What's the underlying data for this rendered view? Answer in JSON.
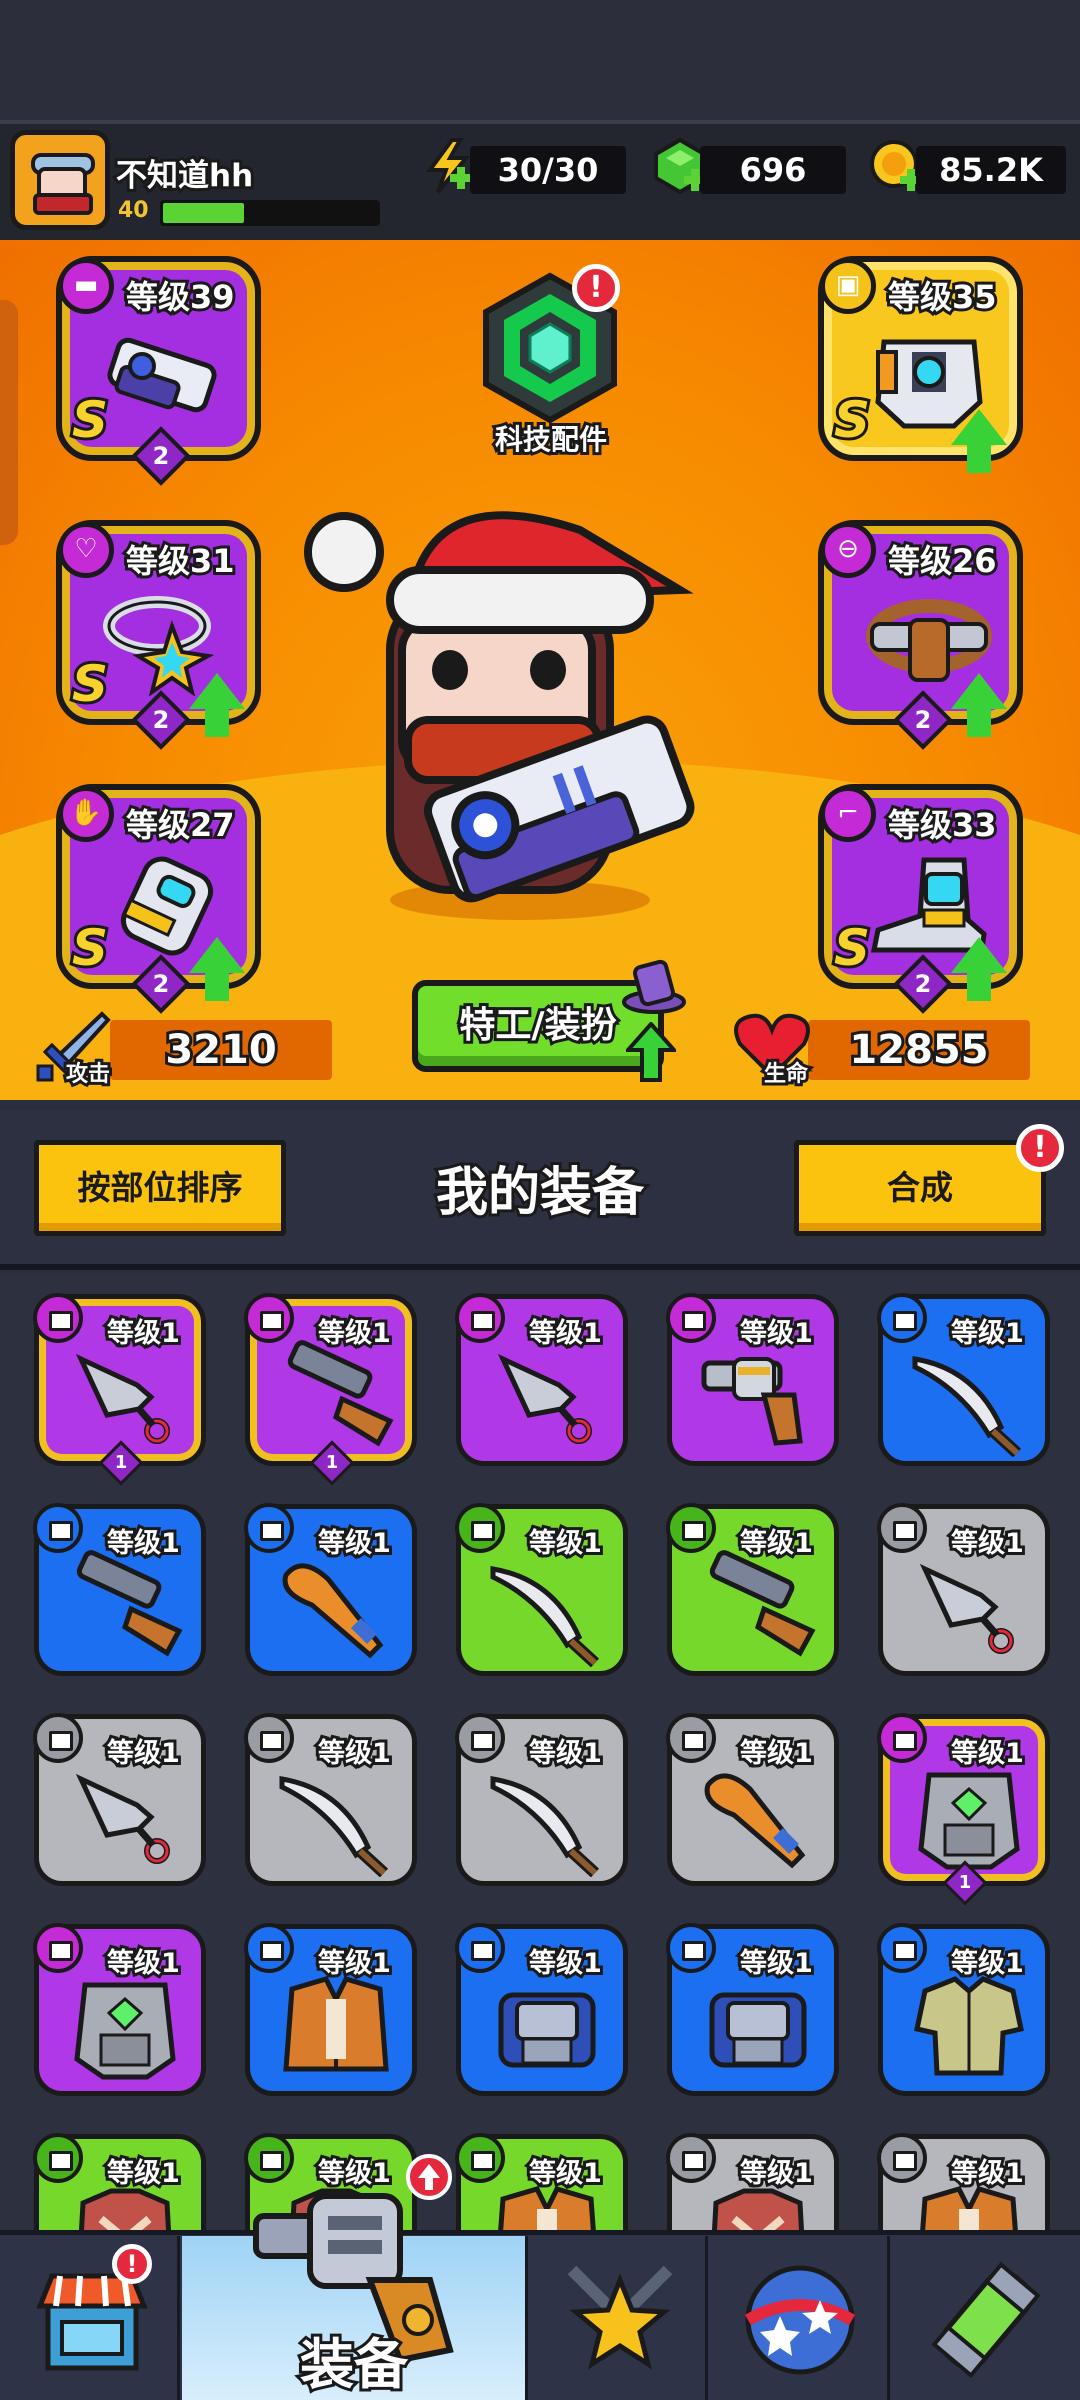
{
  "player": {
    "name": "不知道hh",
    "level": "40",
    "xp_fraction": 0.38
  },
  "resources": {
    "energy": "30/30",
    "gems": "696",
    "coins": "85.2K"
  },
  "tech_parts": {
    "label": "科技配件",
    "alert": "!"
  },
  "slots": [
    {
      "level": "等级39",
      "rank": "S",
      "stars": "2",
      "icon": "gun-icon"
    },
    {
      "level": "等级35",
      "rank": "S",
      "icon": "armor-icon"
    },
    {
      "level": "等级31",
      "rank": "S",
      "stars": "2",
      "icon": "necklace-icon"
    },
    {
      "level": "等级26",
      "rank": "",
      "stars": "2",
      "icon": "belt-icon"
    },
    {
      "level": "等级27",
      "rank": "S",
      "stars": "2",
      "icon": "glove-icon"
    },
    {
      "level": "等级33",
      "rank": "S",
      "stars": "2",
      "icon": "boot-icon"
    }
  ],
  "stats": {
    "attack_label": "攻击",
    "attack": "3210",
    "health_label": "生命",
    "health": "12855"
  },
  "agent_button": "特工/装扮",
  "inventory": {
    "sort_label": "按部位排序",
    "title": "我的装备",
    "merge_label": "合成",
    "merge_alert": "!",
    "level_text": "等级1",
    "items": [
      {
        "rarity": "purple",
        "icon": "kunai-icon",
        "star": "1"
      },
      {
        "rarity": "purple",
        "icon": "shotgun-icon",
        "star": "1"
      },
      {
        "rarity": "purple",
        "icon": "kunai-icon"
      },
      {
        "rarity": "purple",
        "icon": "revolver-icon"
      },
      {
        "rarity": "blue",
        "icon": "machete-icon"
      },
      {
        "rarity": "blue",
        "icon": "shotgun-icon"
      },
      {
        "rarity": "blue",
        "icon": "bat-icon"
      },
      {
        "rarity": "green",
        "icon": "machete-icon"
      },
      {
        "rarity": "green",
        "icon": "shotgun-icon"
      },
      {
        "rarity": "gray",
        "icon": "kunai-icon"
      },
      {
        "rarity": "gray",
        "icon": "kunai-icon"
      },
      {
        "rarity": "gray",
        "icon": "machete-icon"
      },
      {
        "rarity": "gray",
        "icon": "machete-icon"
      },
      {
        "rarity": "gray",
        "icon": "bat-icon"
      },
      {
        "rarity": "purple",
        "icon": "vest-icon",
        "star": "1"
      },
      {
        "rarity": "purple",
        "icon": "vest-icon"
      },
      {
        "rarity": "blue",
        "icon": "jacket-icon"
      },
      {
        "rarity": "blue",
        "icon": "armor-vest-icon"
      },
      {
        "rarity": "blue",
        "icon": "armor-vest-icon"
      },
      {
        "rarity": "blue",
        "icon": "shirt-icon"
      },
      {
        "rarity": "green",
        "icon": "tunic-icon"
      },
      {
        "rarity": "green",
        "icon": "tunic-icon"
      },
      {
        "rarity": "green",
        "icon": "jacket-icon"
      },
      {
        "rarity": "gray",
        "icon": "tunic-icon"
      },
      {
        "rarity": "gray",
        "icon": "jacket-icon"
      }
    ]
  },
  "nav": {
    "shop_alert": "!",
    "equip_label": "装备"
  },
  "colors": {
    "purple": "#b138e6",
    "blue": "#1c6ff0",
    "green": "#75d82b",
    "gray": "#b5b7bd",
    "orange": "#f78a00"
  }
}
